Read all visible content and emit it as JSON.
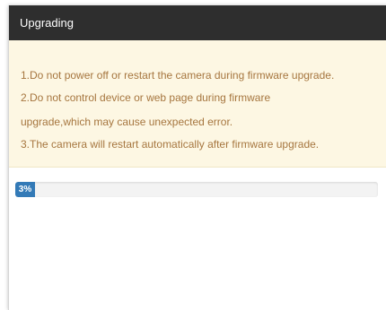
{
  "dialog": {
    "title": "Upgrading",
    "notice_lines": [
      "1.Do not power off or restart the camera during firmware upgrade.",
      "2.Do not control device or web page during firmware",
      "upgrade,which may cause unexpected error.",
      "3.The camera will restart automatically after firmware upgrade."
    ],
    "progress": {
      "value_percent": 3,
      "label": "3%"
    }
  },
  "colors": {
    "titlebar": "#2e2e2e",
    "notice_bg": "#fdf7e3",
    "notice_text": "#a6763f",
    "progress_fill": "#337ab7"
  }
}
